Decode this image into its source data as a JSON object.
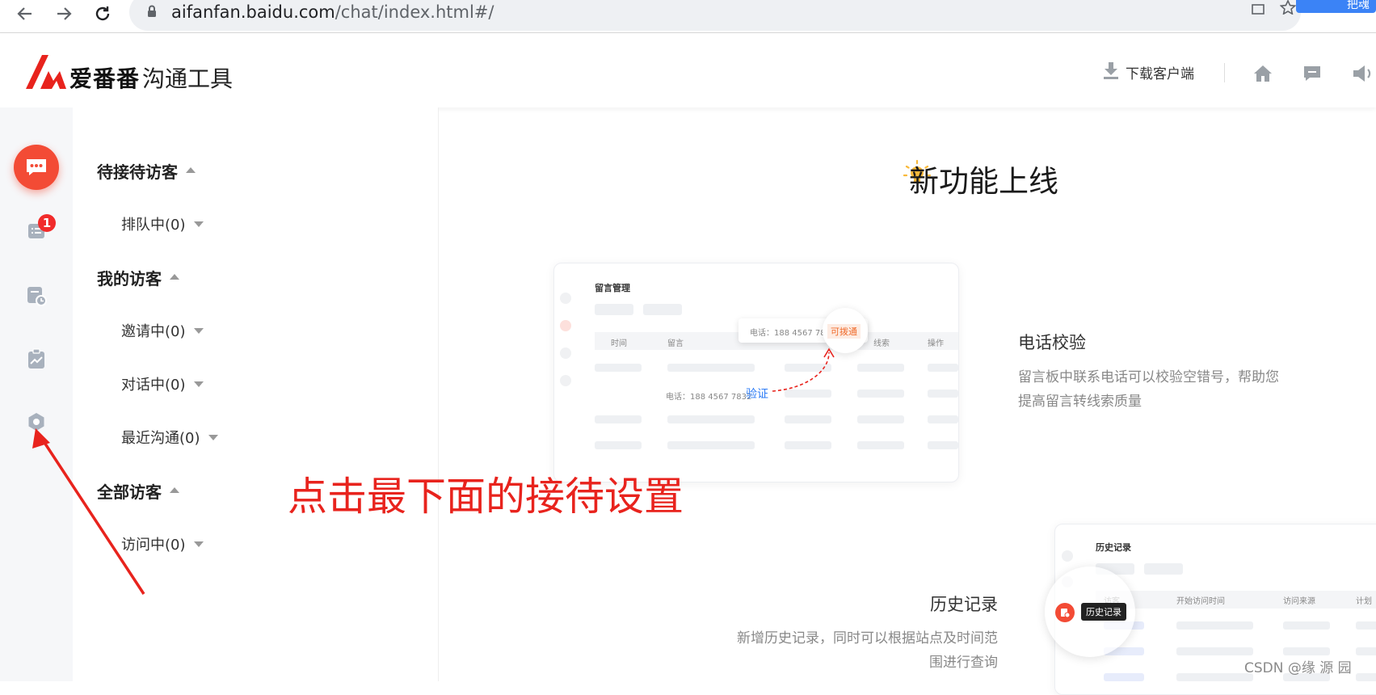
{
  "browser": {
    "url_host": "aifanfan.baidu.com",
    "url_path": "/chat/index.html#/",
    "extension_label": "把魂"
  },
  "header": {
    "brand": "爱番番",
    "product": "沟通工具",
    "download_label": "下载客户端",
    "icons": [
      "home-icon",
      "message-icon",
      "speaker-icon"
    ]
  },
  "rail": {
    "items": [
      "chat-icon",
      "visitor-list-icon",
      "history-icon",
      "report-icon",
      "settings-icon"
    ],
    "badge": "1",
    "accent": "#f34b35"
  },
  "visitor_list": {
    "groups": [
      {
        "label": "待接待访客",
        "items": [
          "排队中(0)"
        ]
      },
      {
        "label": "我的访客",
        "items": [
          "邀请中(0)",
          "对话中(0)",
          "最近沟通(0)"
        ]
      },
      {
        "label": "全部访客",
        "items": [
          "访问中(0)"
        ]
      }
    ]
  },
  "main": {
    "heading": "新功能上线",
    "feature1": {
      "title": "电话校验",
      "desc": "留言板中联系电话可以校验空错号，帮助您提高留言转线索质量",
      "mock": {
        "title": "留言管理",
        "col_time": "时间",
        "col_msg": "留言",
        "col_clue": "线索",
        "col_op": "操作",
        "phone_text": "电话：188 4567 7832",
        "phone_tag": "可拨通",
        "verify_label": "验证"
      }
    },
    "feature2": {
      "title": "历史记录",
      "desc": "新增历史记录，同时可以根据站点及时间范围进行查询",
      "mock": {
        "title": "历史记录",
        "col_visitor": "访客",
        "col_start": "开始访问时间",
        "col_source": "访问来源",
        "col_plan": "计划",
        "tooltip": "历史记录"
      }
    }
  },
  "annotation": {
    "text": "点击最下面的接待设置",
    "color": "#e8231d"
  },
  "watermark": "CSDN @缘 源 园"
}
